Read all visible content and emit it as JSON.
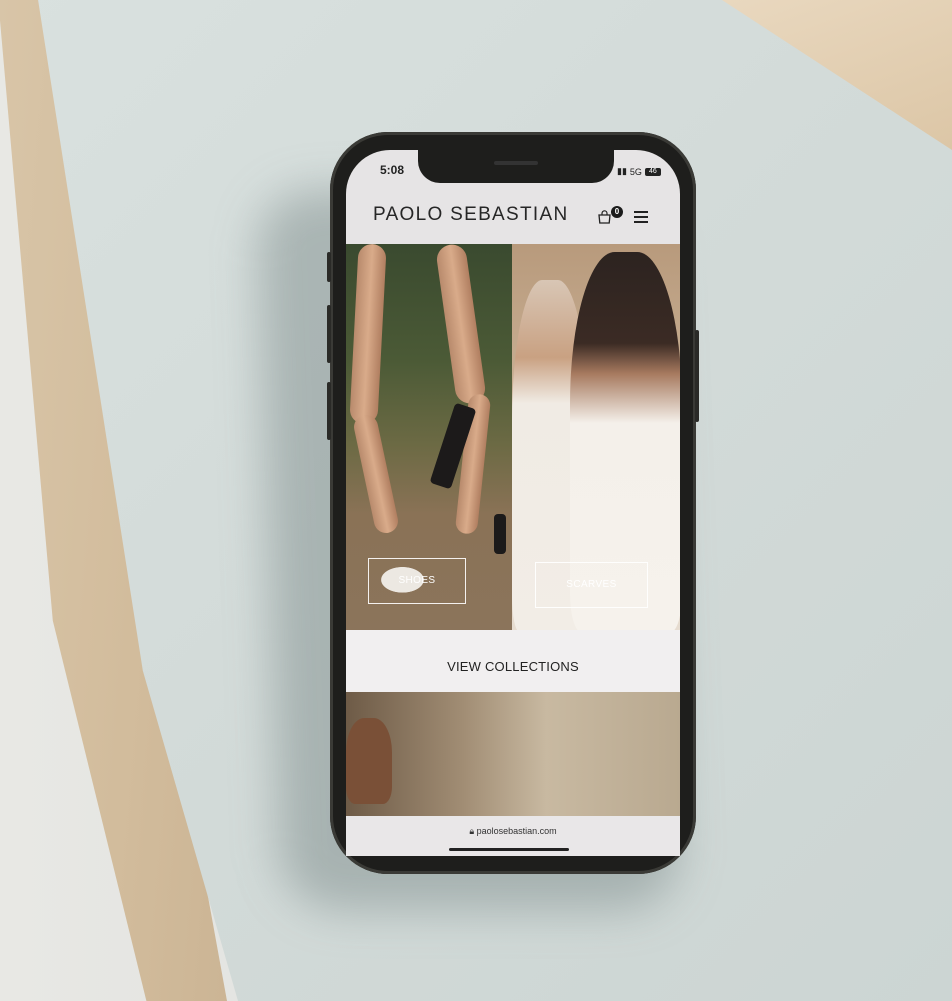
{
  "status_bar": {
    "time": "5:08",
    "network": "5G",
    "battery": "46"
  },
  "header": {
    "brand": "PAOLO SEBASTIAN",
    "bag_count": "0"
  },
  "tiles": {
    "left": {
      "label": "SHOES"
    },
    "right": {
      "label": "SCARVES"
    }
  },
  "collections": {
    "label": "VIEW COLLECTIONS"
  },
  "browser": {
    "url": "paolosebastian.com"
  }
}
